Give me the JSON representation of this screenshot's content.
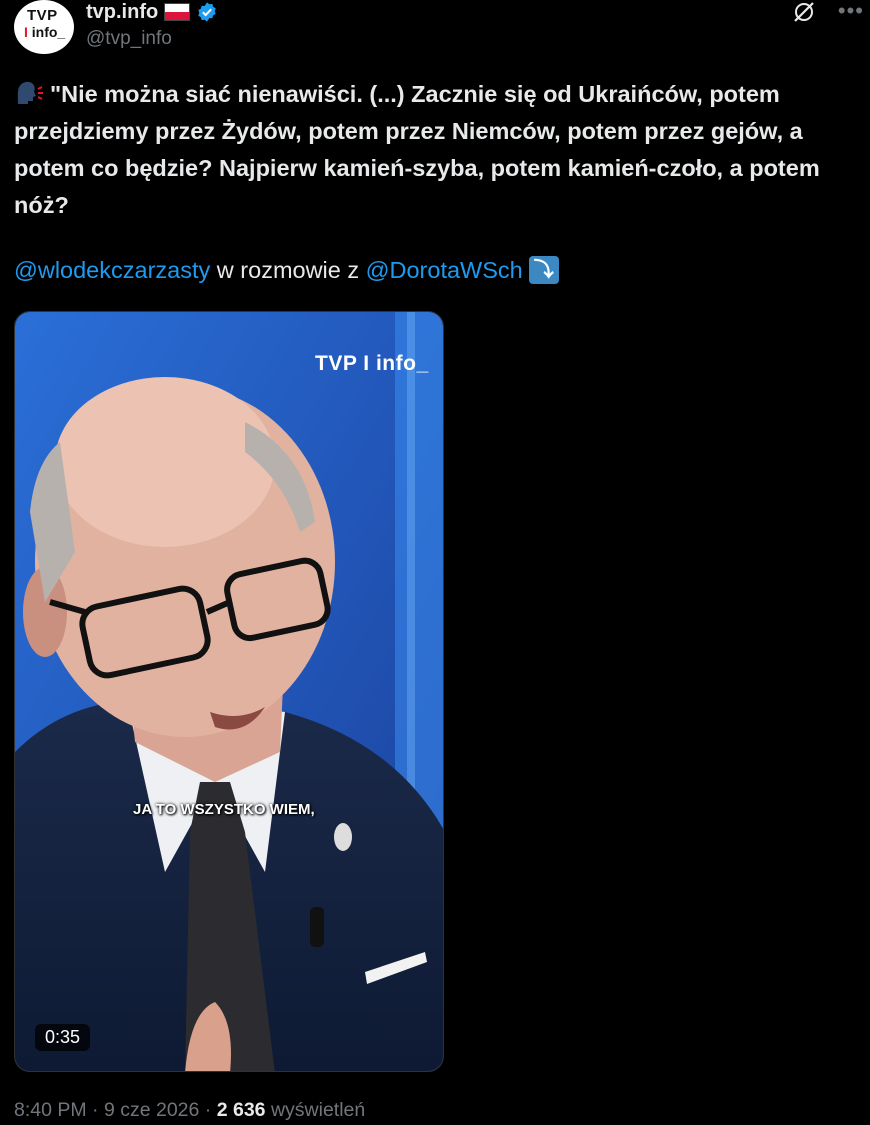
{
  "account": {
    "name": "tvp.info",
    "handle": "@tvp_info",
    "avatar_line1": "TVP",
    "avatar_bar": "I",
    "avatar_line2": "info_"
  },
  "tweet": {
    "emoji_icon": "speaking-head-icon",
    "text": "\"Nie można siać nienawiści. (...) Zacznie się od Ukraińców, potem przejdziemy przez Żydów, potem przez Niemców, potem przez gejów, a potem co będzie? Najpierw kamień-szyba, potem kamień-czoło, a potem nóż?",
    "mention1": "@wlodekczarzasty",
    "middle": " w rozmowie z ",
    "mention2": "@DorotaWSch",
    "arrow": "⤵"
  },
  "video": {
    "logo": "TVP I info_",
    "caption": "JA TO WSZYSTKO WIEM,",
    "duration": "0:35"
  },
  "meta": {
    "time": "8:40 PM",
    "sep1": " · ",
    "date": "9 cze 2026",
    "sep2": " · ",
    "views": "2 636",
    "views_label": " wyświetleń"
  },
  "colors": {
    "accent": "#1d9bf0",
    "muted": "#71767b",
    "text": "#e7e9ea",
    "background": "#000000"
  }
}
